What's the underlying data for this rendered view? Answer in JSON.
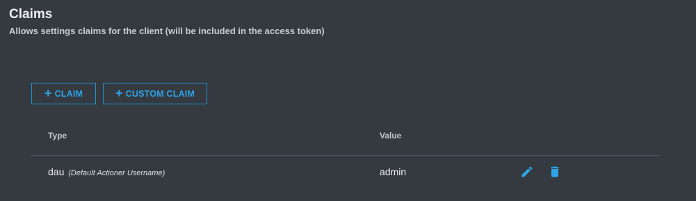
{
  "section": {
    "title": "Claims",
    "subtitle": "Allows settings claims for the client (will be included in the access token)"
  },
  "buttons": {
    "add_claim_label": "CLAIM",
    "add_custom_claim_label": "CUSTOM CLAIM"
  },
  "table": {
    "columns": [
      "Type",
      "Value"
    ],
    "rows": [
      {
        "type": "dau",
        "type_description": "(Default Actioner Username)",
        "value": "admin"
      }
    ]
  },
  "icons": {
    "plus": "plus-icon",
    "edit": "pencil-icon",
    "delete": "trash-icon"
  },
  "colors": {
    "background": "#343a40",
    "accent": "#2ea3e6"
  }
}
